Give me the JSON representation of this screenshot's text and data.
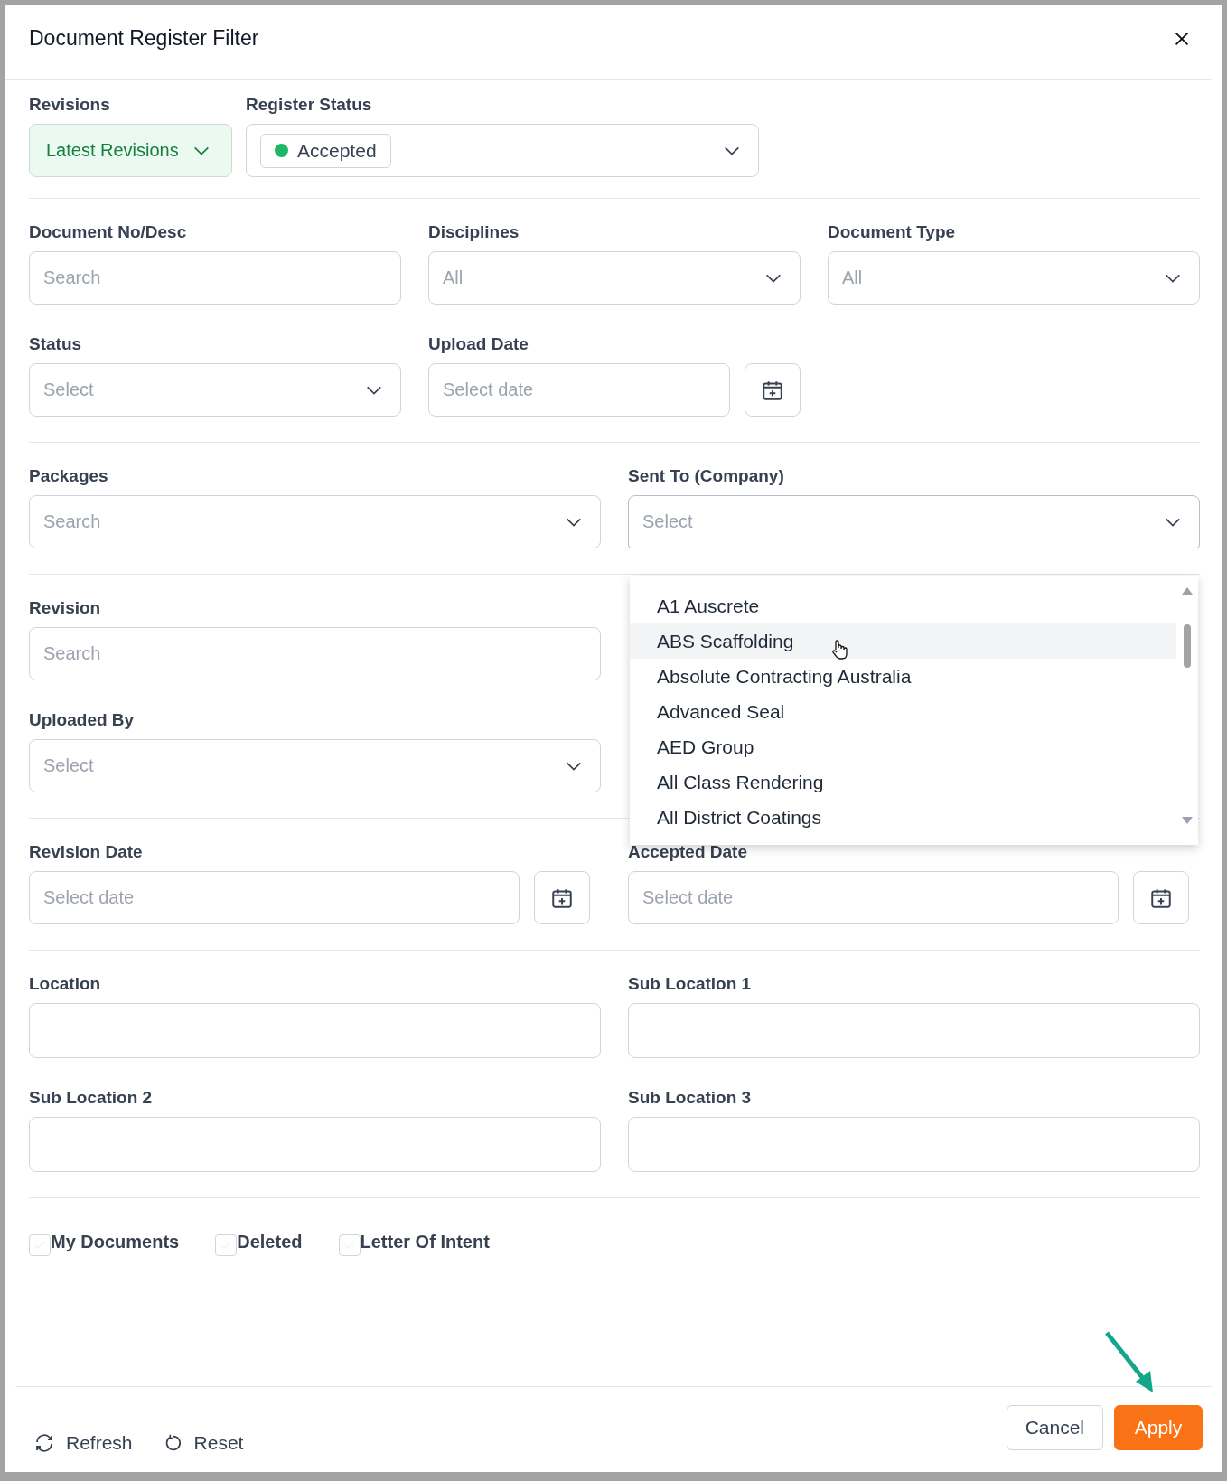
{
  "dialog": {
    "title": "Document Register Filter"
  },
  "sections": [
    {
      "kind": "top",
      "fields": [
        {
          "kind": "pill-select",
          "label": "Revisions",
          "value": "Latest Revisions"
        },
        {
          "kind": "tag-select",
          "label": "Register Status",
          "tag": {
            "text": "Accepted",
            "color": "#1db865"
          }
        }
      ]
    },
    {
      "kind": "three-column",
      "fields": [
        {
          "kind": "search",
          "label": "Document No/Desc",
          "placeholder": "Search"
        },
        {
          "kind": "select",
          "label": "Disciplines",
          "placeholder": "All"
        },
        {
          "kind": "select",
          "label": "Document Type",
          "placeholder": "All"
        },
        {
          "kind": "select",
          "label": "Status",
          "placeholder": "Select"
        },
        {
          "kind": "date",
          "label": "Upload Date",
          "placeholder": "Select date"
        }
      ]
    },
    {
      "kind": "two-column",
      "fields": [
        {
          "kind": "select",
          "label": "Packages",
          "placeholder": "Search"
        },
        {
          "kind": "select",
          "label": "Sent To (Company)",
          "placeholder": "Select",
          "expanded": true,
          "options": [
            {
              "label": "A1 Auscrete",
              "highlighted": false
            },
            {
              "label": "ABS Scaffolding",
              "highlighted": true
            },
            {
              "label": "Absolute Contracting Australia",
              "highlighted": false
            },
            {
              "label": "Advanced Seal",
              "highlighted": false
            },
            {
              "label": "AED Group",
              "highlighted": false
            },
            {
              "label": "All Class Rendering",
              "highlighted": false
            },
            {
              "label": "All District Coatings",
              "highlighted": false
            }
          ]
        }
      ]
    },
    {
      "kind": "left-column",
      "fields": [
        {
          "kind": "search",
          "label": "Revision",
          "placeholder": "Search"
        },
        {
          "kind": "select",
          "label": "Uploaded By",
          "placeholder": "Select"
        }
      ]
    },
    {
      "kind": "two-column",
      "fields": [
        {
          "kind": "date",
          "label": "Revision Date",
          "placeholder": "Select date"
        },
        {
          "kind": "date",
          "label": "Accepted Date",
          "placeholder": "Select date"
        }
      ]
    },
    {
      "kind": "two-column",
      "fields": [
        {
          "kind": "text",
          "label": "Location"
        },
        {
          "kind": "text",
          "label": "Sub Location 1"
        },
        {
          "kind": "text",
          "label": "Sub Location 2"
        },
        {
          "kind": "text",
          "label": "Sub Location 3"
        }
      ]
    }
  ],
  "checkboxes": [
    {
      "label": "My Documents",
      "checked": false
    },
    {
      "label": "Deleted",
      "checked": false
    },
    {
      "label": "Letter Of Intent",
      "checked": false
    }
  ],
  "footer": {
    "actions": [
      {
        "kind": "refresh",
        "label": "Refresh"
      },
      {
        "kind": "reset",
        "label": "Reset"
      }
    ],
    "buttons": [
      {
        "kind": "secondary",
        "label": "Cancel"
      },
      {
        "kind": "primary",
        "label": "Apply"
      }
    ]
  }
}
